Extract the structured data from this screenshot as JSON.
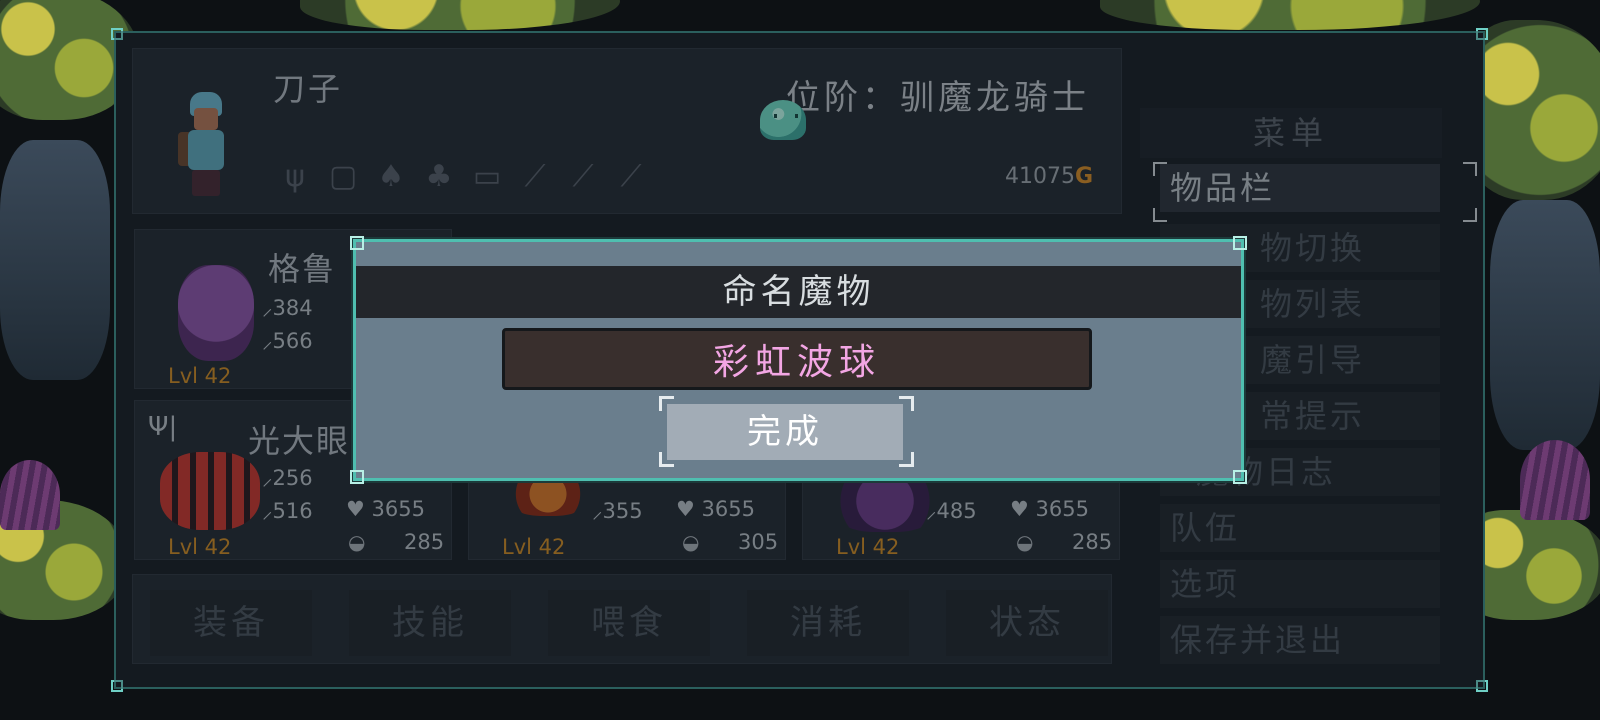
{
  "player": {
    "name": "刀子",
    "rank": "位阶：驯魔龙骑士",
    "gold_amount": "41075",
    "gold_symbol": "G",
    "equip_icons": [
      "claw-icon",
      "armor-icon",
      "mushroom-icon",
      "acorn-icon",
      "book-icon",
      "feather-icon",
      "feather-icon",
      "feather-icon"
    ]
  },
  "monsters": [
    {
      "name": "格鲁",
      "atk": "384",
      "def": "566",
      "level": "Lvl 42",
      "icon": "purple-dragon-sprite"
    },
    {
      "name": "光大眼",
      "atk": "256",
      "def": "516",
      "hp": "3655",
      "food": "285",
      "level": "Lvl 42",
      "icon": "red-raccoon-sprite"
    },
    {
      "name": "",
      "def": "355",
      "hp": "3655",
      "food": "305",
      "level": "Lvl 42",
      "icon": "orange-crab-sprite"
    },
    {
      "name": "",
      "def": "485",
      "hp": "3655",
      "food": "285",
      "level": "Lvl 42",
      "icon": "purple-witch-sprite"
    }
  ],
  "tabs": [
    "装备",
    "技能",
    "喂食",
    "消耗",
    "状态"
  ],
  "menu": {
    "title": "菜单",
    "items": [
      "物品栏",
      "物切换",
      "物列表",
      "魔引导",
      "常提示",
      "魔物日志",
      "队伍",
      "选项",
      "保存并退出"
    ],
    "selected_index": 0
  },
  "dialog": {
    "title": "命名魔物",
    "name_value": "彩虹波球",
    "confirm_label": "完成"
  },
  "colors": {
    "accent": "#4fbfb0",
    "gold": "#d08a2a",
    "name_text": "#f3a6e4",
    "level_text": "#c98a28"
  }
}
